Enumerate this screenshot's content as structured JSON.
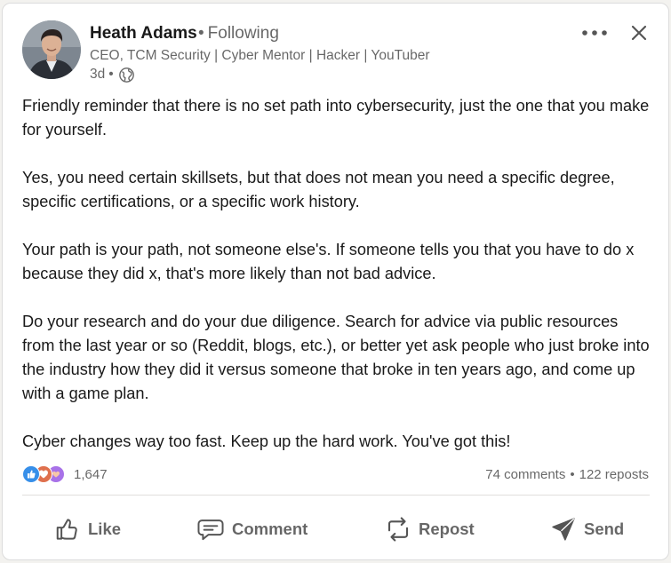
{
  "post": {
    "author": {
      "name": "Heath Adams",
      "connection": "Following",
      "headline": "CEO, TCM Security | Cyber Mentor | Hacker | YouTuber",
      "time": "3d",
      "visibility_icon": "globe-icon"
    },
    "header_icons": {
      "more": "more-options-icon",
      "close": "close-icon"
    },
    "body": [
      "Friendly reminder that there is no set path into cybersecurity, just the one that you make for yourself.",
      "Yes, you need certain skillsets, but that does not mean you need a specific degree, specific certifications, or a specific work history.",
      "Your path is your path, not someone else's. If someone tells you that you have to do x because they did x, that's more likely than not bad advice.",
      "Do your research and do your due diligence. Search for advice via public resources from the last year or so (Reddit, blogs, etc.), or better yet ask people who just broke into the industry how they did it versus someone that broke in ten years ago, and come up with a game plan.",
      "Cyber changes way too fast. Keep up the hard work. You've got this!"
    ],
    "social": {
      "reaction_count": "1,647",
      "reaction_icons": [
        "like-reaction-icon",
        "love-reaction-icon",
        "support-reaction-icon"
      ],
      "comments": "74 comments",
      "reposts": "122 reposts"
    },
    "actions": {
      "like": "Like",
      "comment": "Comment",
      "repost": "Repost",
      "send": "Send"
    }
  },
  "colors": {
    "like_blue": "#378fe9",
    "love_red": "#df704d",
    "support_purple": "#a872e8",
    "text_primary": "#191919",
    "text_secondary": "#666666"
  }
}
